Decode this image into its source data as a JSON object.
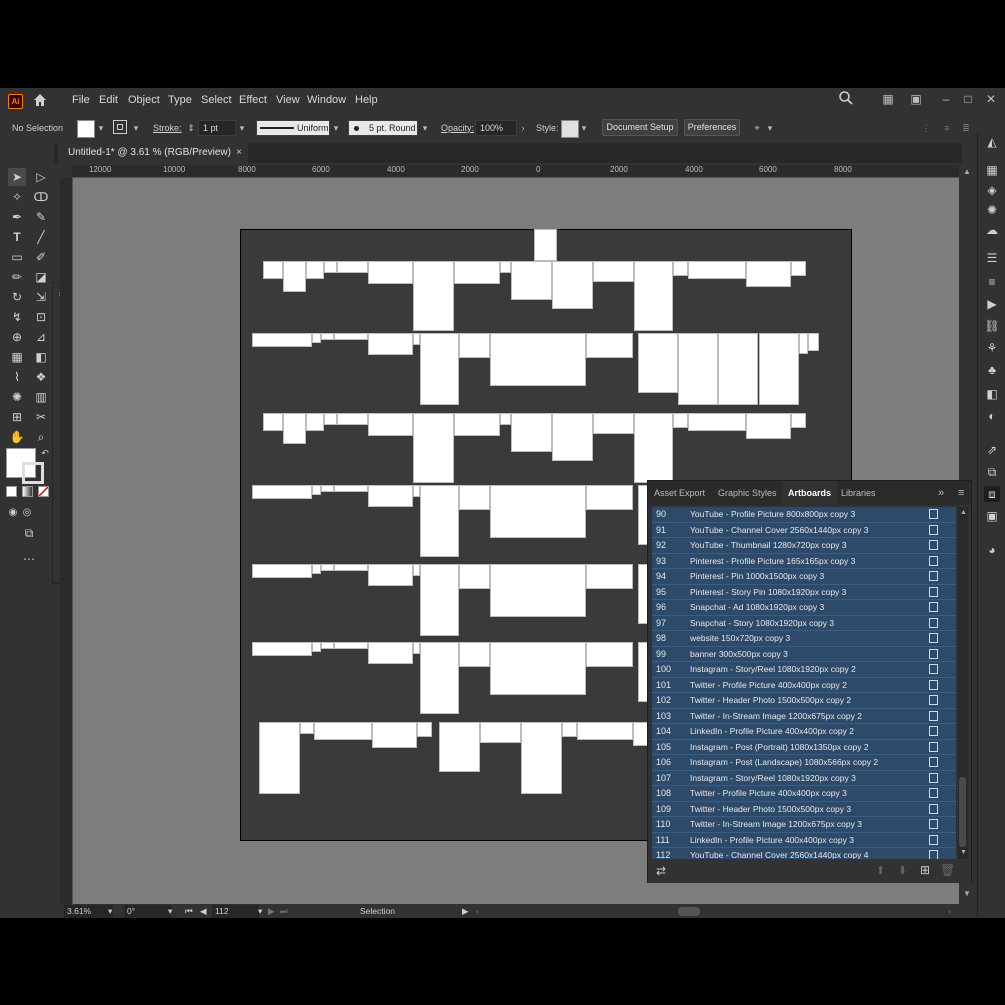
{
  "app": {
    "logo": "Ai",
    "menu": [
      "File",
      "Edit",
      "Object",
      "Type",
      "Select",
      "Effect",
      "View",
      "Window",
      "Help"
    ]
  },
  "control_bar": {
    "selection": "No Selection",
    "stroke_label": "Stroke:",
    "stroke_weight": "1 pt",
    "profile": "Uniform",
    "brush": "5 pt. Round",
    "opacity_label": "Opacity:",
    "opacity": "100%",
    "style_label": "Style:",
    "document_setup": "Document Setup",
    "preferences": "Preferences"
  },
  "document": {
    "tab_title": "Untitled-1* @ 3.61 % (RGB/Preview)",
    "close": "×"
  },
  "ruler": {
    "ticks": [
      "12000",
      "10000",
      "8000",
      "6000",
      "4000",
      "2000",
      "0",
      "2000",
      "4000",
      "6000",
      "8000"
    ]
  },
  "status_bar": {
    "zoom": "3.61%",
    "rotation": "0°",
    "artboard_number": "112",
    "tool": "Selection"
  },
  "panel": {
    "tabs": [
      "Asset Export",
      "Graphic Styles",
      "Artboards",
      "Libraries"
    ],
    "active_tab": "Artboards",
    "rows": [
      {
        "num": "90",
        "name": "YouTube - Profile Picture 800x800px copy 3"
      },
      {
        "num": "91",
        "name": "YouTube - Channel Cover 2560x1440px copy 3"
      },
      {
        "num": "92",
        "name": "YouTube - Thumbnail 1280x720px copy 3"
      },
      {
        "num": "93",
        "name": "Pinterest - Profile Picture 165x165px copy 3"
      },
      {
        "num": "94",
        "name": "Pinterest - Pin 1000x1500px copy 3"
      },
      {
        "num": "95",
        "name": "Pinterest - Story Pin 1080x1920px copy 3"
      },
      {
        "num": "96",
        "name": "Snapchat - Ad 1080x1920px copy 3"
      },
      {
        "num": "97",
        "name": "Snapchat - Story 1080x1920px copy 3"
      },
      {
        "num": "98",
        "name": "website 150x720px copy 3"
      },
      {
        "num": "99",
        "name": "banner 300x500px copy 3"
      },
      {
        "num": "100",
        "name": "Instagram - Story/Reel 1080x1920px copy 2"
      },
      {
        "num": "101",
        "name": "Twitter - Profile Picture 400x400px copy 2"
      },
      {
        "num": "102",
        "name": "Twitter - Header Photo 1500x500px copy 2"
      },
      {
        "num": "103",
        "name": "Twitter - In-Stream Image 1200x675px copy 2"
      },
      {
        "num": "104",
        "name": "LinkedIn - Profile Picture 400x400px copy 2"
      },
      {
        "num": "105",
        "name": "Instagram - Post (Portrait) 1080x1350px copy 2"
      },
      {
        "num": "106",
        "name": "Instagram - Post (Landscape) 1080x566px copy 2"
      },
      {
        "num": "107",
        "name": "Instagram - Story/Reel 1080x1920px copy 3"
      },
      {
        "num": "108",
        "name": "Twitter - Profile Picture 400x400px copy 3"
      },
      {
        "num": "109",
        "name": "Twitter - Header Photo 1500x500px copy 3"
      },
      {
        "num": "110",
        "name": "Twitter - In-Stream Image 1200x675px copy 3"
      },
      {
        "num": "111",
        "name": "LinkedIn - Profile Picture 400x400px copy 3"
      },
      {
        "num": "112",
        "name": "YouTube - Channel Cover 2560x1440px copy 4"
      }
    ]
  },
  "colors": {
    "chrome": "#323232",
    "canvas": "#7d7d7d",
    "artboard_area": "#3a3a3a",
    "selected_row": "#2d4a6a",
    "logo_orange": "#ff7c00"
  }
}
